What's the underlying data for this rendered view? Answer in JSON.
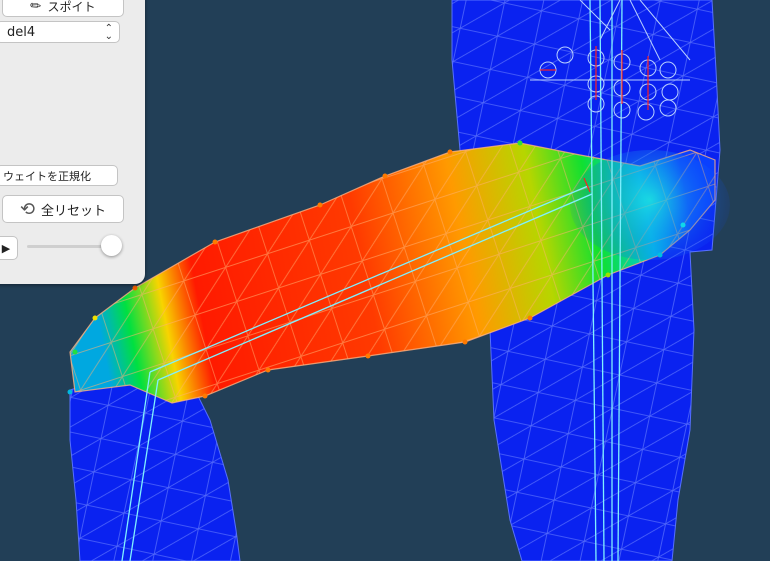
{
  "panel": {
    "eyedropper_label": "スポイト",
    "model_select_value": "del4",
    "normalize_weight_label": "ウェイトを正規化",
    "reset_all_label": "全リセット"
  },
  "icons": {
    "eyedropper": "eyedropper-icon",
    "reset": "reset-arrows-icon",
    "play": "play-icon",
    "select": "chevron-updown-icon"
  },
  "colors": {
    "background": "#223f57",
    "weight_high": "#ff1a00",
    "weight_mid": "#00e000",
    "weight_low": "#0022ee"
  }
}
